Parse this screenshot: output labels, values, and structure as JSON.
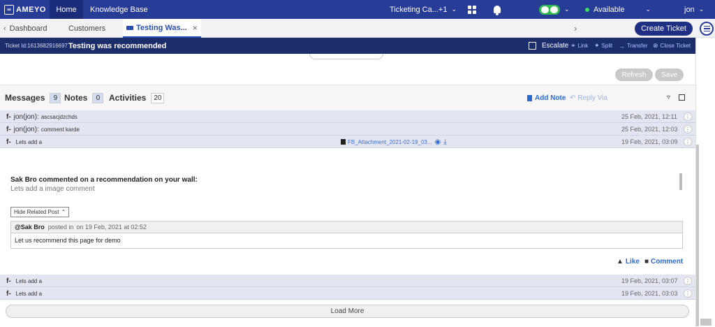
{
  "topbar": {
    "logo_text": "AMEYO",
    "home": "Home",
    "knowledge_base": "Knowledge Base",
    "campaign": "Ticketing Ca...+1",
    "status": "Available",
    "user": "jon"
  },
  "tabs": {
    "dashboard": "Dashboard",
    "customers": "Customers",
    "active": "Testing Was...",
    "create_ticket": "Create Ticket"
  },
  "ticket": {
    "id_label": "Ticket Id:1613682916697",
    "title": "Testing was recommended",
    "escalate": "Escalate",
    "link": "Link",
    "split": "Split",
    "transfer": "Transfer",
    "close": "Close Ticket"
  },
  "actions": {
    "refresh": "Refresh",
    "save": "Save"
  },
  "interactions": {
    "messages_label": "Messages",
    "messages_count": "9",
    "notes_label": "Notes",
    "notes_count": "0",
    "activities_label": "Activities",
    "activities_count": "20",
    "add_note": "Add Note",
    "reply_via": "Reply Via"
  },
  "rows": [
    {
      "prefix": "f-",
      "author": "jon(jon):",
      "text": "ascsacjdzchds",
      "date": "25 Feb, 2021, 12:11"
    },
    {
      "prefix": "f-",
      "author": "jon(jon):",
      "text": "comment karde",
      "date": "25 Feb, 2021, 12:03"
    },
    {
      "prefix": "f-",
      "author": "",
      "text": "Lets add a",
      "date": "19 Feb, 2021, 03:09",
      "attachment": "FB_Attachment_2021-02-19_03..."
    },
    {
      "prefix": "f-",
      "author": "",
      "text": "Lets add a",
      "date": "19 Feb, 2021, 03:07"
    },
    {
      "prefix": "f-",
      "author": "",
      "text": "Lets add a",
      "date": "19 Feb, 2021, 03:03"
    }
  ],
  "detail": {
    "heading": "Sak Bro commented on a recommendation on your wall:",
    "subtext": "Lets add a image comment",
    "hide_related": "Hide Related Post",
    "post_author": "@Sak Bro",
    "post_posted_in": "posted in",
    "post_date": "on 19 Feb, 2021 at 02:52",
    "post_body": "Let us recommend this page for demo",
    "like": "Like",
    "comment": "Comment"
  },
  "load_more": "Load More",
  "colors": {
    "topbar": "#273c97",
    "ticketbar": "#1c2d6c",
    "accent": "#2a6bd2",
    "row_bg": "#e3e6f2",
    "available": "#3ddc5b"
  },
  "icons": [
    "ameyo-logo-icon",
    "grid-icon",
    "bell-icon",
    "chat-icon",
    "chevron-down-icon",
    "chevron-left-icon",
    "chevron-right-icon",
    "close-icon",
    "menu-icon",
    "link-icon",
    "split-icon",
    "transfer-icon",
    "close-circle-icon",
    "filter-icon",
    "expand-icon",
    "note-icon",
    "reply-icon",
    "kebab-icon",
    "file-icon",
    "eye-icon",
    "download-icon",
    "thumbs-up-icon",
    "comment-icon"
  ]
}
